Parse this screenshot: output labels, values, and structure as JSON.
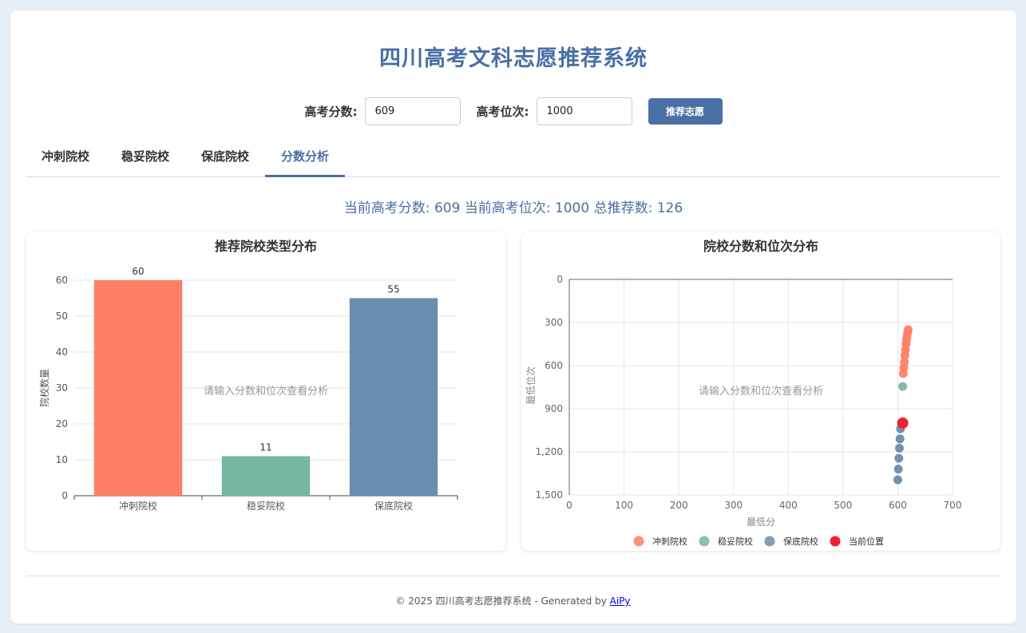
{
  "app_title": "四川高考文科志愿推荐系统",
  "form": {
    "score_label": "高考分数:",
    "score_value": "609",
    "rank_label": "高考位次:",
    "rank_value": "1000",
    "submit_label": "推荐志愿"
  },
  "tabs": [
    {
      "label": "冲刺院校",
      "active": false
    },
    {
      "label": "稳妥院校",
      "active": false
    },
    {
      "label": "保底院校",
      "active": false
    },
    {
      "label": "分数分析",
      "active": true
    }
  ],
  "summary": "当前高考分数: 609 当前高考位次: 1000 总推荐数: 126",
  "colors": {
    "chong": "#ff7f66",
    "wen": "#76b79f",
    "bao": "#6a8caf",
    "current": "#ee2233",
    "accent": "#4a6fa5"
  },
  "chart_data": [
    {
      "type": "bar",
      "title": "推荐院校类型分布",
      "categories": [
        "冲刺院校",
        "稳妥院校",
        "保底院校"
      ],
      "values": [
        60,
        11,
        55
      ],
      "ylabel": "院校数量",
      "ylim": [
        0,
        60
      ],
      "yticks": [
        "0",
        "10",
        "20",
        "30",
        "40",
        "50",
        "60"
      ],
      "overlay_text": "请输入分数和位次查看分析",
      "grid": true
    },
    {
      "type": "scatter",
      "title": "院校分数和位次分布",
      "xlabel": "最低分",
      "ylabel": "最低位次",
      "xlim": [
        0,
        700
      ],
      "ylim": [
        0,
        1500
      ],
      "y_inverted": true,
      "xticks": [
        "0",
        "100",
        "200",
        "300",
        "400",
        "500",
        "600",
        "700"
      ],
      "yticks": [
        "0",
        "300",
        "600",
        "900",
        "1,200",
        "1,500"
      ],
      "overlay_text": "请输入分数和位次查看分析",
      "legend": [
        "冲刺院校",
        "稳妥院校",
        "保底院校",
        "当前位置"
      ],
      "legend_position": "bottom",
      "series": [
        {
          "name": "冲刺院校",
          "points": [
            [
              619,
              350
            ],
            [
              618,
              370
            ],
            [
              617,
              395
            ],
            [
              616,
              420
            ],
            [
              615,
              450
            ],
            [
              614,
              490
            ],
            [
              613,
              530
            ],
            [
              612,
              575
            ],
            [
              611,
              615
            ],
            [
              610,
              655
            ]
          ]
        },
        {
          "name": "稳妥院校",
          "points": [
            [
              609,
              745
            ]
          ]
        },
        {
          "name": "保底院校",
          "points": [
            [
              605,
              1040
            ],
            [
              604,
              1110
            ],
            [
              603,
              1175
            ],
            [
              602,
              1245
            ],
            [
              601,
              1320
            ],
            [
              600,
              1395
            ]
          ]
        },
        {
          "name": "当前位置",
          "points": [
            [
              609,
              1000
            ]
          ]
        }
      ]
    }
  ],
  "footer": {
    "text": "© 2025 四川高考志愿推荐系统 - Generated by ",
    "link": "AiPy"
  }
}
